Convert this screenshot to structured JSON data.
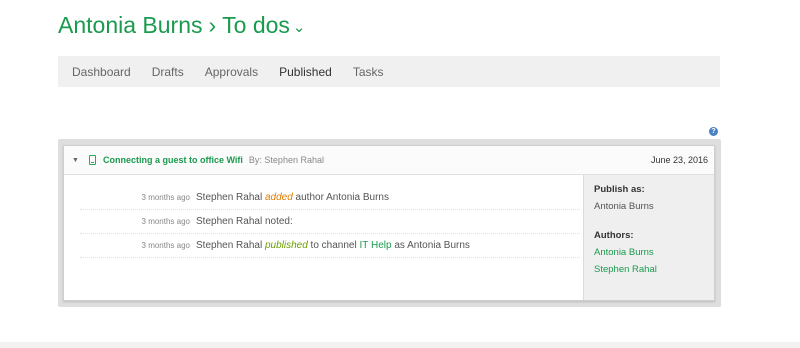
{
  "header": {
    "owner": "Antonia Burns",
    "separator": "›",
    "section": "To dos",
    "chevron": "⌄"
  },
  "nav": {
    "tabs": [
      {
        "label": "Dashboard"
      },
      {
        "label": "Drafts"
      },
      {
        "label": "Approvals"
      },
      {
        "label": "Published"
      },
      {
        "label": "Tasks"
      }
    ],
    "active_tab": "Published"
  },
  "help_icon": "?",
  "card": {
    "caret": "▼",
    "device_icon": "mobile-device-icon",
    "title": "Connecting a guest to office Wifi",
    "by": "By: Stephen Rahal",
    "date": "June 23, 2016",
    "activity": [
      {
        "time": "3 months ago",
        "actor": "Stephen Rahal",
        "verb": "added",
        "middle": "author",
        "object": "Antonia Burns"
      },
      {
        "time": "3 months ago",
        "actor": "Stephen Rahal",
        "text": "noted:"
      },
      {
        "time": "3 months ago",
        "actor": "Stephen Rahal",
        "verb": "published",
        "middle": "to channel",
        "channel": "IT Help",
        "tail": "as Antonia Burns"
      }
    ],
    "side": {
      "publish_as_label": "Publish as:",
      "publish_as_value": "Antonia Burns",
      "authors_label": "Authors:",
      "authors": [
        "Antonia Burns",
        "Stephen Rahal"
      ]
    }
  },
  "colors": {
    "brand_green": "#1a9a4e",
    "added_orange": "#e07b00",
    "published_green": "#6a9e00"
  }
}
